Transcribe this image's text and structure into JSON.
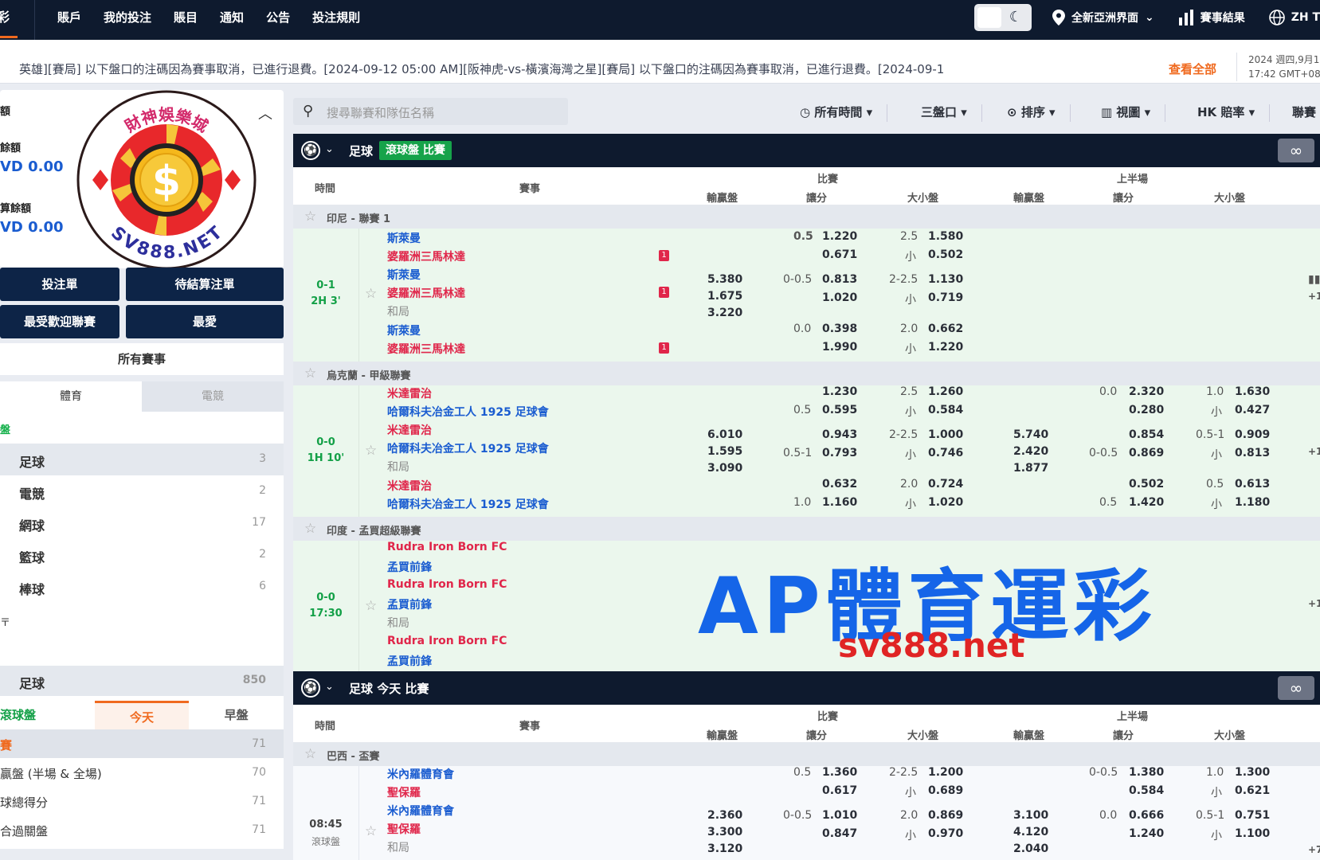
{
  "nav": {
    "brand": "彩",
    "menu": [
      "賬戶",
      "我的投注",
      "賬目",
      "通知",
      "公告",
      "投注規則"
    ],
    "region": "全新亞洲界面",
    "results": "賽事結果",
    "lang": "ZH T"
  },
  "marquee": {
    "text": "英雄][賽局]    以下盤口的注碼因為賽事取消，已進行退費。[2024-09-12 05:00 AM][阪神虎-vs-橫濱海灣之星][賽局]    以下盤口的注碼因為賽事取消，已進行退費。[2024-09-1",
    "view_all": "查看全部",
    "date": "2024 週四,9月1",
    "time": "17:42 GMT+08"
  },
  "sidebar": {
    "balance_title": "額",
    "balance_label": "餘額",
    "balance_value": "VD 0.00",
    "pending_label": "算餘額",
    "pending_value": "VD 0.00",
    "logo_top": "財神娛樂城",
    "logo_bottom": "SV888.NET",
    "logo_symbol": "$",
    "buttons": [
      "投注單",
      "待結算注單",
      "最受歡迎聯賽",
      "最愛"
    ],
    "all_events": "所有賽事",
    "tabs": [
      "體育",
      "電競"
    ],
    "live_label": "盤",
    "sports": [
      {
        "name": "足球",
        "count": "3"
      },
      {
        "name": "電競",
        "count": "2"
      },
      {
        "name": "網球",
        "count": "17"
      },
      {
        "name": "籃球",
        "count": "2"
      },
      {
        "name": "棒球",
        "count": "6"
      }
    ],
    "section_mark": "〒",
    "soccer": {
      "name": "足球",
      "count": "850"
    },
    "time_tabs": [
      "滾球盤",
      "今天",
      "早盤"
    ],
    "markets": [
      {
        "name": "賽",
        "count": "71"
      },
      {
        "name": "贏盤 (半場 & 全場)",
        "count": "70"
      },
      {
        "name": "球總得分",
        "count": "71"
      },
      {
        "name": "合過關盤",
        "count": "71"
      }
    ]
  },
  "toolbar": {
    "search_placeholder": "搜尋聯賽和隊伍名稱",
    "time": "所有時間",
    "market": "三盤口",
    "sort": "排序",
    "view": "視圖",
    "odds": "HK 賠率",
    "league": "聯賽"
  },
  "sections": [
    {
      "title": "足球",
      "badge": "滾球盤 比賽",
      "inf": "∞"
    },
    {
      "title": "足球 今天 比賽",
      "inf": "∞"
    }
  ],
  "colhead": {
    "time": "時間",
    "event": "賽事",
    "full": "比賽",
    "half": "上半場",
    "c1x2": "輸贏盤",
    "chcp": "讓分",
    "cou": "大小盤"
  },
  "leagues": [
    "印尼 - 聯賽 1",
    "烏克蘭 - 甲級聯賽",
    "印度 - 孟買超級聯賽",
    "巴西 - 盃賽"
  ],
  "match1": {
    "score": "0-1",
    "time": "2H 3'",
    "home": "斯萊曼",
    "away": "婆羅洲三馬林達",
    "draw": "和局",
    "red": "1",
    "x1": "5.380",
    "x2": "1.675",
    "x3": "3.220",
    "r1": [
      "0.5",
      "1.220",
      "0.671",
      "2.5",
      "1.580",
      "小",
      "0.502"
    ],
    "r2": [
      "0-0.5",
      "0.813",
      "1.020",
      "2-2.5",
      "1.130",
      "小",
      "0.719"
    ],
    "r3": [
      "0.0",
      "0.398",
      "1.990",
      "2.0",
      "0.662",
      "小",
      "1.220"
    ],
    "extra": "+1"
  },
  "match2": {
    "score": "0-0",
    "time": "1H 10'",
    "home": "米達雷治",
    "away": "哈爾科夫冶金工人 1925 足球會",
    "draw": "和局",
    "x1": "6.010",
    "x2": "1.595",
    "x3": "3.090",
    "r1": [
      "1.230",
      "0.5",
      "0.595",
      "2.5",
      "1.260",
      "小",
      "0.584"
    ],
    "r2": [
      "0.943",
      "0.5-1",
      "0.793",
      "2-2.5",
      "1.000",
      "小",
      "0.746"
    ],
    "r3": [
      "0.632",
      "1.0",
      "1.160",
      "2.0",
      "0.724",
      "小",
      "1.020"
    ],
    "h1": [
      "5.740",
      "2.420",
      "1.877"
    ],
    "hr1": [
      "0.0",
      "2.320",
      "0.280",
      "1.0",
      "1.630",
      "小",
      "0.427"
    ],
    "hr2": [
      "0.854",
      "0-0.5",
      "0.869",
      "0.5-1",
      "0.909",
      "小",
      "0.813"
    ],
    "hr3": [
      "0.502",
      "0.5",
      "1.420",
      "0.5",
      "0.613",
      "小",
      "1.180"
    ],
    "extra": "+1"
  },
  "match3": {
    "score": "0-0",
    "time": "17:30",
    "home": "Rudra Iron Born FC",
    "away": "孟買前鋒",
    "draw": "和局",
    "extra": "+1"
  },
  "match4": {
    "time": "08:45",
    "tag": "滾球盤",
    "home": "米內羅體育會",
    "away": "聖保羅",
    "draw": "和局",
    "x1": "2.360",
    "x2": "3.300",
    "x3": "3.120",
    "r1": [
      "0.5",
      "1.360",
      "0.617",
      "2-2.5",
      "1.200",
      "小",
      "0.689"
    ],
    "r2": [
      "0-0.5",
      "1.010",
      "0.847",
      "2.0",
      "0.869",
      "小",
      "0.970"
    ],
    "h1": [
      "3.100",
      "4.120",
      "2.040"
    ],
    "hr1": [
      "0-0.5",
      "1.380",
      "0.584",
      "1.0",
      "1.300",
      "小",
      "0.621"
    ],
    "hr2": [
      "0.0",
      "0.666",
      "1.240",
      "0.5-1",
      "0.751",
      "小",
      "1.100"
    ],
    "extra": "+7"
  },
  "watermark": {
    "title": "AP體育運彩",
    "url": "sv888.net"
  },
  "colors": {
    "navy": "#0e1a2e",
    "accent": "#f06a1f",
    "live": "#16a34a",
    "team": "#1a5cd0",
    "teamAway": "#e0264a"
  }
}
